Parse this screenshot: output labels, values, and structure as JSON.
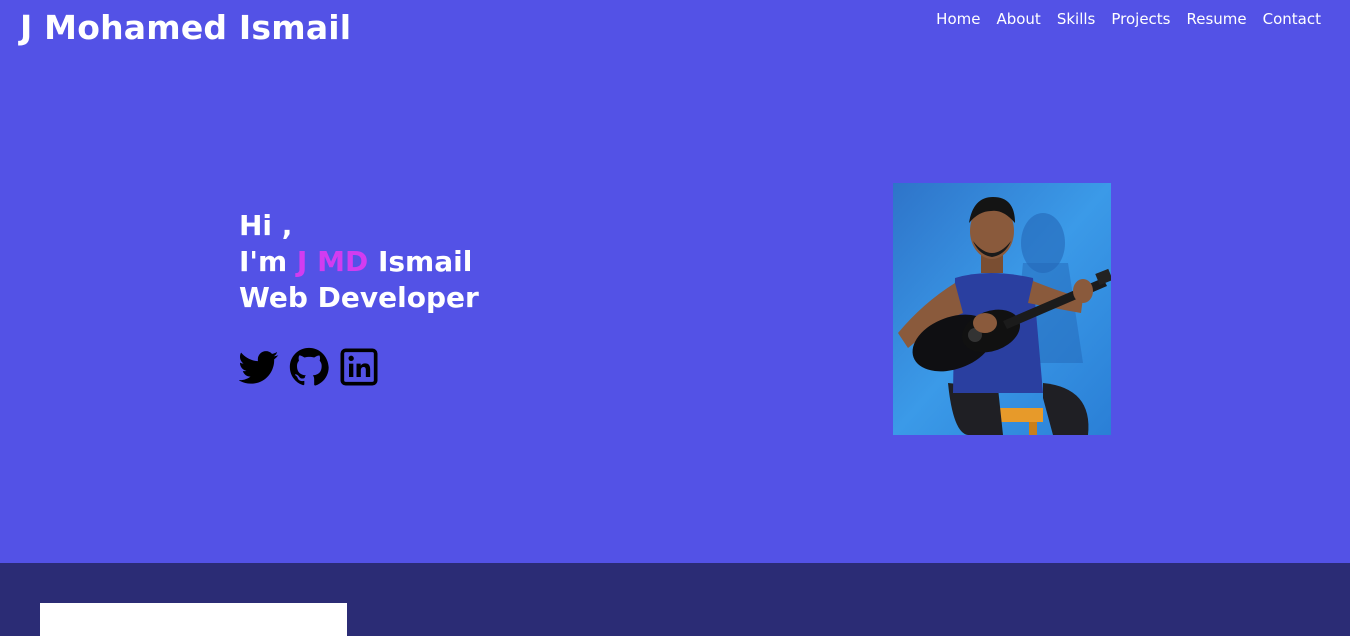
{
  "brand": {
    "name": "J Mohamed Ismail"
  },
  "nav": {
    "items": [
      {
        "label": "Home"
      },
      {
        "label": "About"
      },
      {
        "label": "Skills"
      },
      {
        "label": "Projects"
      },
      {
        "label": "Resume"
      },
      {
        "label": "Contact"
      }
    ]
  },
  "hero": {
    "greeting": "Hi ,",
    "intro_prefix": "I'm ",
    "name_highlight": "J MD",
    "name_rest": " Ismail",
    "role": "Web Developer"
  },
  "socials": [
    {
      "icon": "twitter-icon"
    },
    {
      "icon": "github-icon"
    },
    {
      "icon": "linkedin-icon"
    }
  ],
  "colors": {
    "background": "#5352e6",
    "accent": "#d23cf0",
    "footer": "#2b2c75",
    "text": "#ffffff"
  }
}
